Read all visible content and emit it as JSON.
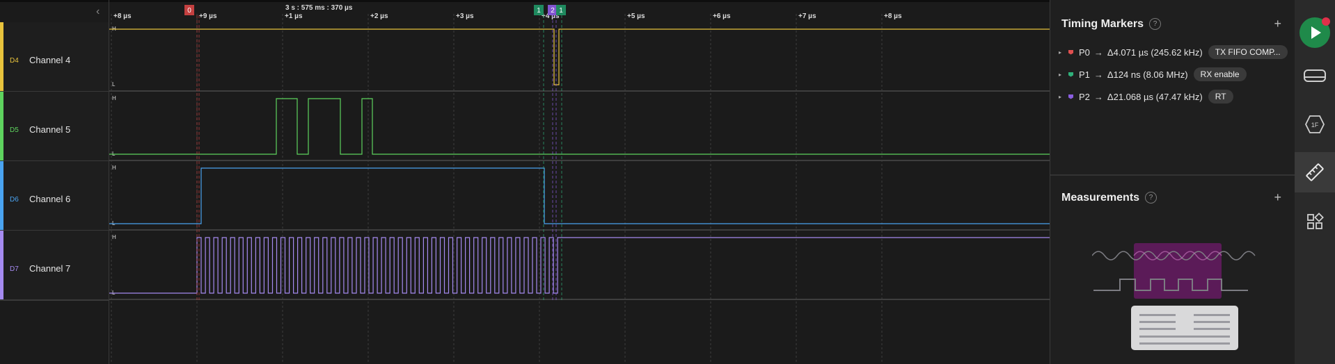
{
  "channels": [
    {
      "code": "D4",
      "name": "Channel 4",
      "color": "#e8c33c"
    },
    {
      "code": "D5",
      "name": "Channel 5",
      "color": "#5ed35e"
    },
    {
      "code": "D6",
      "name": "Channel 6",
      "color": "#4aa3f0"
    },
    {
      "code": "D7",
      "name": "Channel 7",
      "color": "#a58af0"
    }
  ],
  "timeline": {
    "ticks": [
      "+8 µs",
      "+9 µs",
      "+1 µs",
      "+2 µs",
      "+3 µs",
      "+4 µs",
      "+5 µs",
      "+6 µs",
      "+7 µs",
      "+8 µs"
    ],
    "center_label": "3 s : 575 ms : 370 µs",
    "markers": [
      {
        "label": "0",
        "color": "#c44040"
      },
      {
        "label": "1",
        "color": "#1f8a5f"
      },
      {
        "label": "2",
        "color": "#8155d0"
      },
      {
        "label": "1",
        "color": "#1f8a5f"
      }
    ],
    "level_high": "H",
    "level_low": "L"
  },
  "timing_markers": {
    "title": "Timing Markers",
    "help": "?",
    "add": "+",
    "items": [
      {
        "name": "P0",
        "color": "#e05050",
        "arrow": "→",
        "delta": "Δ4.071 µs (245.62 kHz)",
        "tag": "TX FIFO COMP..."
      },
      {
        "name": "P1",
        "color": "#2fb07a",
        "arrow": "→",
        "delta": "Δ124 ns (8.06 MHz)",
        "tag": "RX enable"
      },
      {
        "name": "P2",
        "color": "#8b5ee0",
        "arrow": "→",
        "delta": "Δ21.068 µs (47.47 kHz)",
        "tag": "RT"
      }
    ]
  },
  "measurements": {
    "title": "Measurements",
    "help": "?",
    "add": "+"
  },
  "toolbar": [
    {
      "name": "play-button-icon"
    },
    {
      "name": "device-icon"
    },
    {
      "name": "analyzer-icon",
      "text": "1F"
    },
    {
      "name": "ruler-icon"
    },
    {
      "name": "extensions-icon"
    }
  ]
}
